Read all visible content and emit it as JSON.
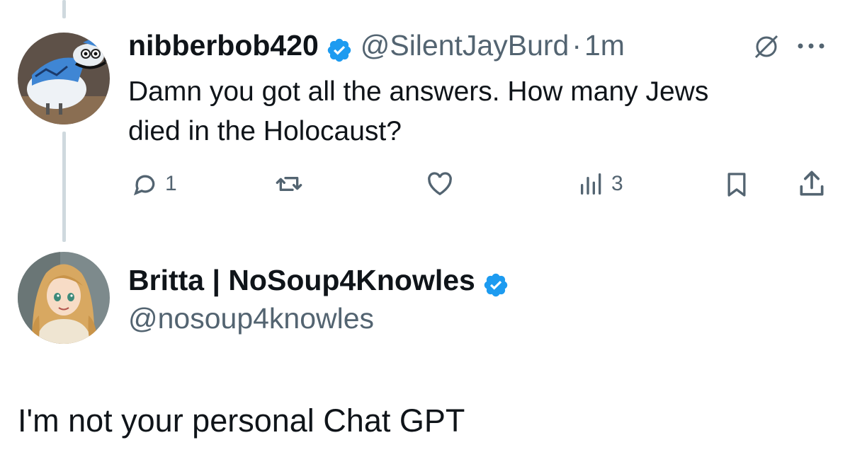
{
  "parent_tweet": {
    "display_name": "nibberbob420",
    "handle": "@SilentJayBurd",
    "separator": "·",
    "timestamp": "1m",
    "text_line1": "Damn you got all the answers. How many Jews",
    "text_line2": "died in the Holocaust?",
    "replies": "1",
    "views": "3"
  },
  "reply_tweet": {
    "display_name": "Britta | NoSoup4Knowles",
    "handle": "@nosoup4knowles",
    "text": "I'm not your personal Chat GPT"
  },
  "icons": {
    "verified": "verified-badge-icon",
    "grok": "grok-icon",
    "more": "more-icon",
    "reply": "reply-icon",
    "retweet": "retweet-icon",
    "like": "like-icon",
    "views": "views-icon",
    "bookmark": "bookmark-icon",
    "share": "share-icon"
  },
  "colors": {
    "verified": "#1d9bf0",
    "text": "#0f1419",
    "secondary": "#536471",
    "thread_line": "#cfd9de"
  }
}
